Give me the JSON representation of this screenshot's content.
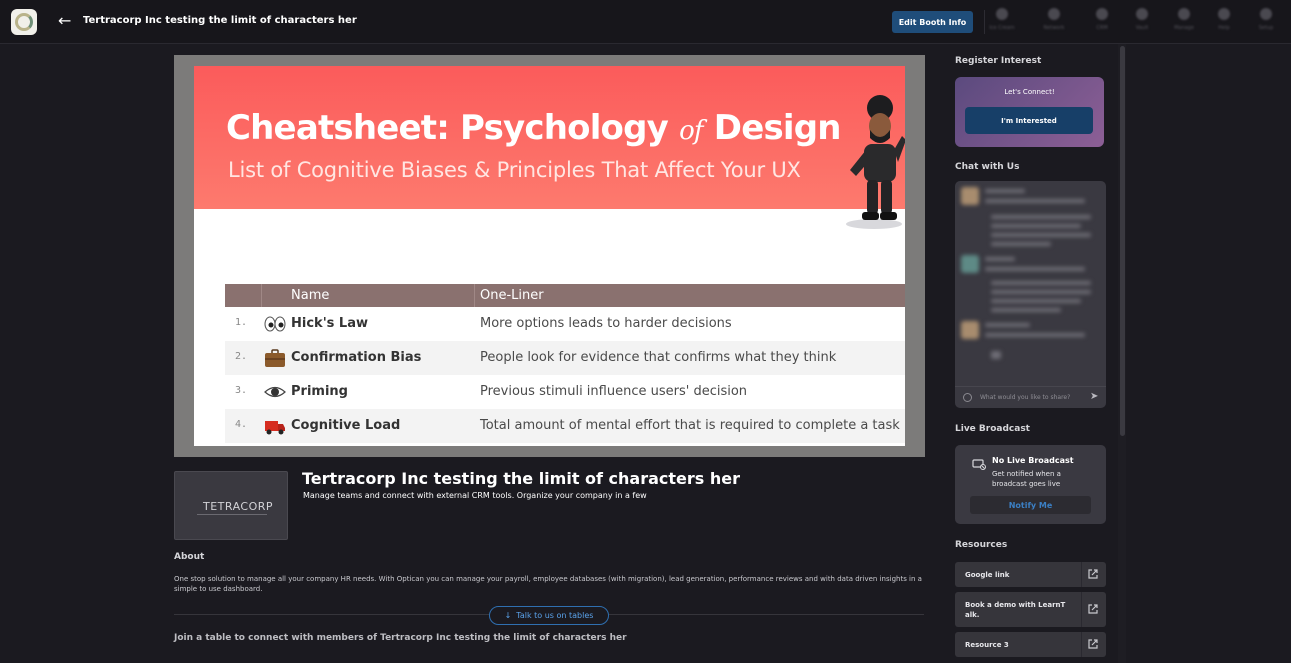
{
  "topbar": {
    "title": "Tertracorp Inc testing the limit of characters her",
    "edit_label": "Edit Booth Info",
    "tools": [
      {
        "label": "Ice Cream",
        "icon": "tool-icon"
      },
      {
        "label": "Network",
        "icon": "tool-icon"
      },
      {
        "label": "CRM",
        "icon": "tool-icon"
      },
      {
        "label": "Vault",
        "icon": "tool-icon"
      },
      {
        "label": "Manage",
        "icon": "tool-icon"
      },
      {
        "label": "Help",
        "icon": "tool-icon"
      },
      {
        "label": "Setup",
        "icon": "tool-icon"
      }
    ]
  },
  "slide": {
    "title_a": "Cheatsheet: Psychology",
    "title_of": "of",
    "title_b": "Design",
    "subtitle": "List of Cognitive Biases & Principles That Affect Your UX",
    "col_name": "Name",
    "col_oneliner": "One-Liner",
    "rows": [
      {
        "num": "1.",
        "name": "Hick's Law",
        "desc": "More options leads to harder decisions"
      },
      {
        "num": "2.",
        "name": "Confirmation Bias",
        "desc": "People look for evidence that confirms what they think"
      },
      {
        "num": "3.",
        "name": "Priming",
        "desc": "Previous stimuli influence users' decision"
      },
      {
        "num": "4.",
        "name": "Cognitive Load",
        "desc": "Total amount of mental effort that is required to complete a task"
      }
    ]
  },
  "booth": {
    "thumb_brand": "TETRACORP",
    "name": "Tertracorp Inc testing the limit of characters her",
    "tagline": "Manage teams and connect with external CRM tools. Organize your company in a few",
    "about_heading": "About",
    "about_text": "One stop solution to manage all your company HR needs. With Optican you can manage your payroll, employee databases (with migration), lead generation, performance reviews and with data driven insights in a simple to use dashboard.",
    "talk_label": "Talk to us on tables",
    "join_text": "Join a table to connect with members of Tertracorp Inc testing the limit of characters her"
  },
  "sidebar": {
    "register_heading": "Register Interest",
    "lets_connect": "Let's Connect!",
    "interested_label": "I'm Interested",
    "chat_heading": "Chat with Us",
    "chat_placeholder": "What would you like to share?",
    "live_heading": "Live Broadcast",
    "live_title": "No Live Broadcast",
    "live_desc": "Get notified when a broadcast goes live",
    "notify_label": "Notify Me",
    "resources_heading": "Resources",
    "resources": [
      {
        "label": "Google link"
      },
      {
        "label": "Book a demo with LearnT alk."
      },
      {
        "label": "Resource 3"
      }
    ]
  },
  "colors": {
    "accent": "#1f4d7a",
    "slide_red": "#fb5b5b",
    "table_header": "#8a716f",
    "link_blue": "#5aa2ea"
  }
}
